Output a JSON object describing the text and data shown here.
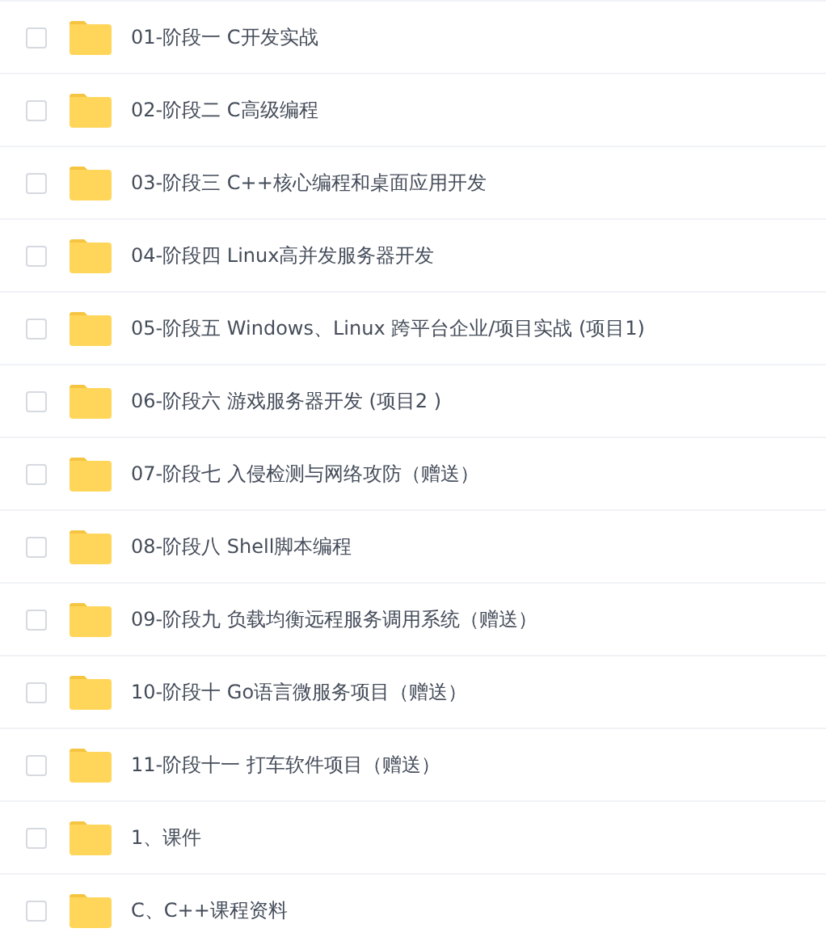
{
  "files": [
    {
      "name": "01-阶段一 C开发实战",
      "checked": false
    },
    {
      "name": "02-阶段二 C高级编程",
      "checked": false
    },
    {
      "name": "03-阶段三 C++核心编程和桌面应用开发",
      "checked": false
    },
    {
      "name": "04-阶段四 Linux高并发服务器开发",
      "checked": false
    },
    {
      "name": "05-阶段五 Windows、Linux 跨平台企业/项目实战 (项目1)",
      "checked": false
    },
    {
      "name": "06-阶段六 游戏服务器开发 (项目2 )",
      "checked": false
    },
    {
      "name": "07-阶段七 入侵检测与网络攻防（赠送）",
      "checked": false
    },
    {
      "name": "08-阶段八 Shell脚本编程",
      "checked": false
    },
    {
      "name": "09-阶段九 负载均衡远程服务调用系统（赠送）",
      "checked": false
    },
    {
      "name": "10-阶段十 Go语言微服务项目（赠送）",
      "checked": false
    },
    {
      "name": "11-阶段十一 打车软件项目（赠送）",
      "checked": false
    },
    {
      "name": "1、课件",
      "checked": false
    },
    {
      "name": "C、C++课程资料",
      "checked": false
    }
  ]
}
